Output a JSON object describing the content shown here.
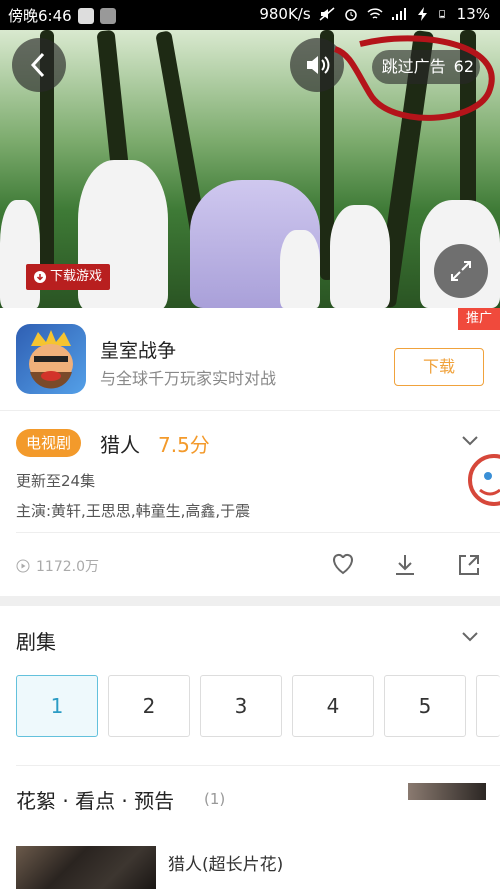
{
  "status_bar": {
    "time": "傍晚6:46",
    "speed": "980K/s",
    "battery": "13%"
  },
  "video": {
    "skip_ad_label": "跳过广告",
    "skip_ad_countdown": "62",
    "download_game_label": "下载游戏"
  },
  "ad": {
    "title": "皇室战争",
    "subtitle": "与全球千万玩家实时对战",
    "download_label": "下载",
    "badge": "推广"
  },
  "show": {
    "type_tag": "电视剧",
    "title": "猎人",
    "score": "7.5分",
    "update": "更新至24集",
    "cast": "主演:黄轩,王思思,韩童生,高鑫,于震",
    "views": "1172.0万"
  },
  "episodes": {
    "title": "剧集",
    "items": [
      "1",
      "2",
      "3",
      "4",
      "5"
    ],
    "selected": "1"
  },
  "extras": {
    "title": "花絮 · 看点 · 预告",
    "count": "(1)",
    "item_title": "猎人(超长片花)"
  },
  "colors": {
    "accent_orange": "#f39a2b",
    "ad_badge_red": "#f04a3c",
    "episode_active": "#63c1dc"
  }
}
